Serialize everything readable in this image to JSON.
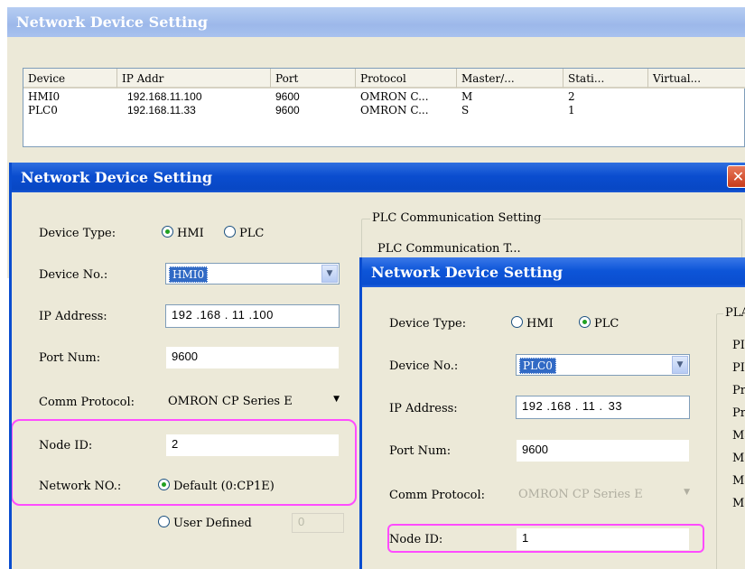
{
  "bg_window": {
    "title": "Network Device Setting",
    "columns": [
      "Device",
      "IP Addr",
      "Port",
      "Protocol",
      "Master/...",
      "Stati...",
      "Virtual..."
    ],
    "rows": [
      [
        "HMI0",
        "192.168.11.100",
        "9600",
        "OMRON C...",
        "M",
        "2",
        ""
      ],
      [
        "PLC0",
        "192.168.11.33",
        "9600",
        "OMRON C...",
        "S",
        "1",
        ""
      ]
    ]
  },
  "dialog1": {
    "title": "Network Device Setting",
    "close_icon": "close-icon",
    "device_type_label": "Device Type:",
    "device_type_options": [
      "HMI",
      "PLC"
    ],
    "device_type_selected": "HMI",
    "device_no_label": "Device No.:",
    "device_no_value": "HMI0",
    "ip_label": "IP Address:",
    "ip_octets": [
      "192",
      "168",
      "11",
      "100"
    ],
    "port_label": "Port Num:",
    "port_value": "9600",
    "protocol_label": "Comm Protocol:",
    "protocol_value": "OMRON CP Series E",
    "node_label": "Node ID:",
    "node_value": "2",
    "network_label": "Network NO.:",
    "network_default": "Default (0:CP1E)",
    "network_user": "User Defined",
    "network_user_value": "0",
    "plc_group_title": "PLC Communication Setting",
    "plc_group_partial": "PLC Communication T..."
  },
  "dialog2": {
    "title": "Network Device Setting",
    "device_type_label": "Device Type:",
    "device_type_options": [
      "HMI",
      "PLC"
    ],
    "device_type_selected": "PLC",
    "device_no_label": "Device No.:",
    "device_no_value": "PLC0",
    "ip_label": "IP Address:",
    "ip_octets": [
      "192",
      "168",
      "11",
      "33"
    ],
    "port_label": "Port Num:",
    "port_value": "9600",
    "protocol_label": "Comm Protocol:",
    "protocol_value": "OMRON CP Series E",
    "node_label": "Node ID:",
    "node_value": "1",
    "group_title_partial": "PLA",
    "group_items_partial": [
      "PI",
      "PI",
      "Pr",
      "Pr",
      "Ma",
      "Ma",
      "Ma",
      "Ma"
    ]
  },
  "colors": {
    "highlight": "#ff4cff",
    "title_active": "#0a4dcf",
    "title_inactive": "#a4bfee",
    "window_bg": "#ece9d8"
  }
}
